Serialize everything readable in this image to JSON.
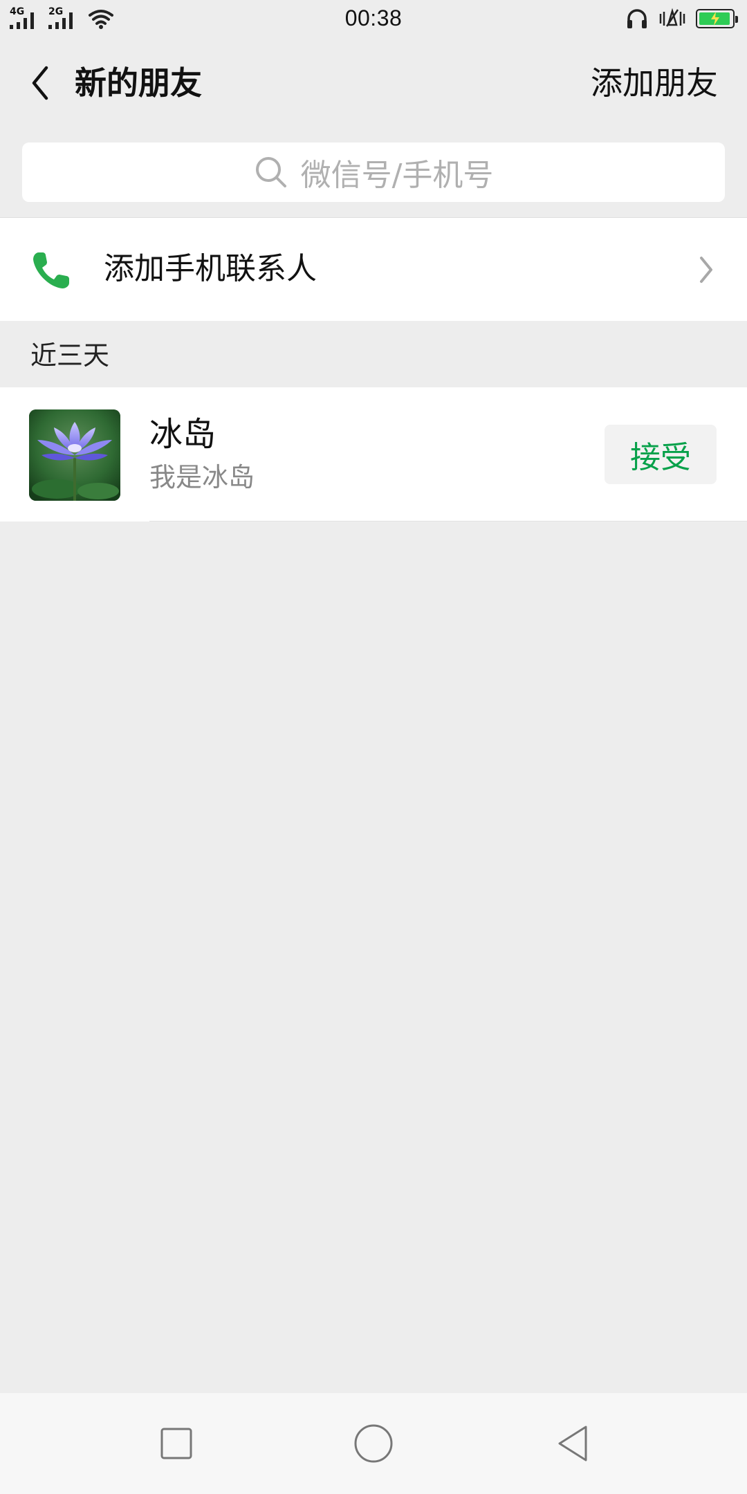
{
  "status_bar": {
    "time": "00:38",
    "sim1_network": "4G",
    "sim2_network": "2G",
    "battery_level": 0.95,
    "battery_color": "#2ecc55",
    "icons": [
      "signal-icon",
      "wifi-icon",
      "headphones-icon",
      "vibrate-icon",
      "battery-icon"
    ]
  },
  "header": {
    "title": "新的朋友",
    "action_label": "添加朋友"
  },
  "search": {
    "placeholder": "微信号/手机号"
  },
  "phone_contacts": {
    "label": "添加手机联系人",
    "icon": "phone-icon",
    "icon_color": "#2aae4f"
  },
  "recent_section": {
    "title": "近三天",
    "requests": [
      {
        "name": "冰岛",
        "message": "我是冰岛",
        "action_label": "接受",
        "avatar": "lotus-flower-avatar"
      }
    ]
  },
  "accent_color": "#07a14a",
  "navigation_bar": {
    "buttons": [
      "recent-apps",
      "home",
      "back"
    ]
  }
}
